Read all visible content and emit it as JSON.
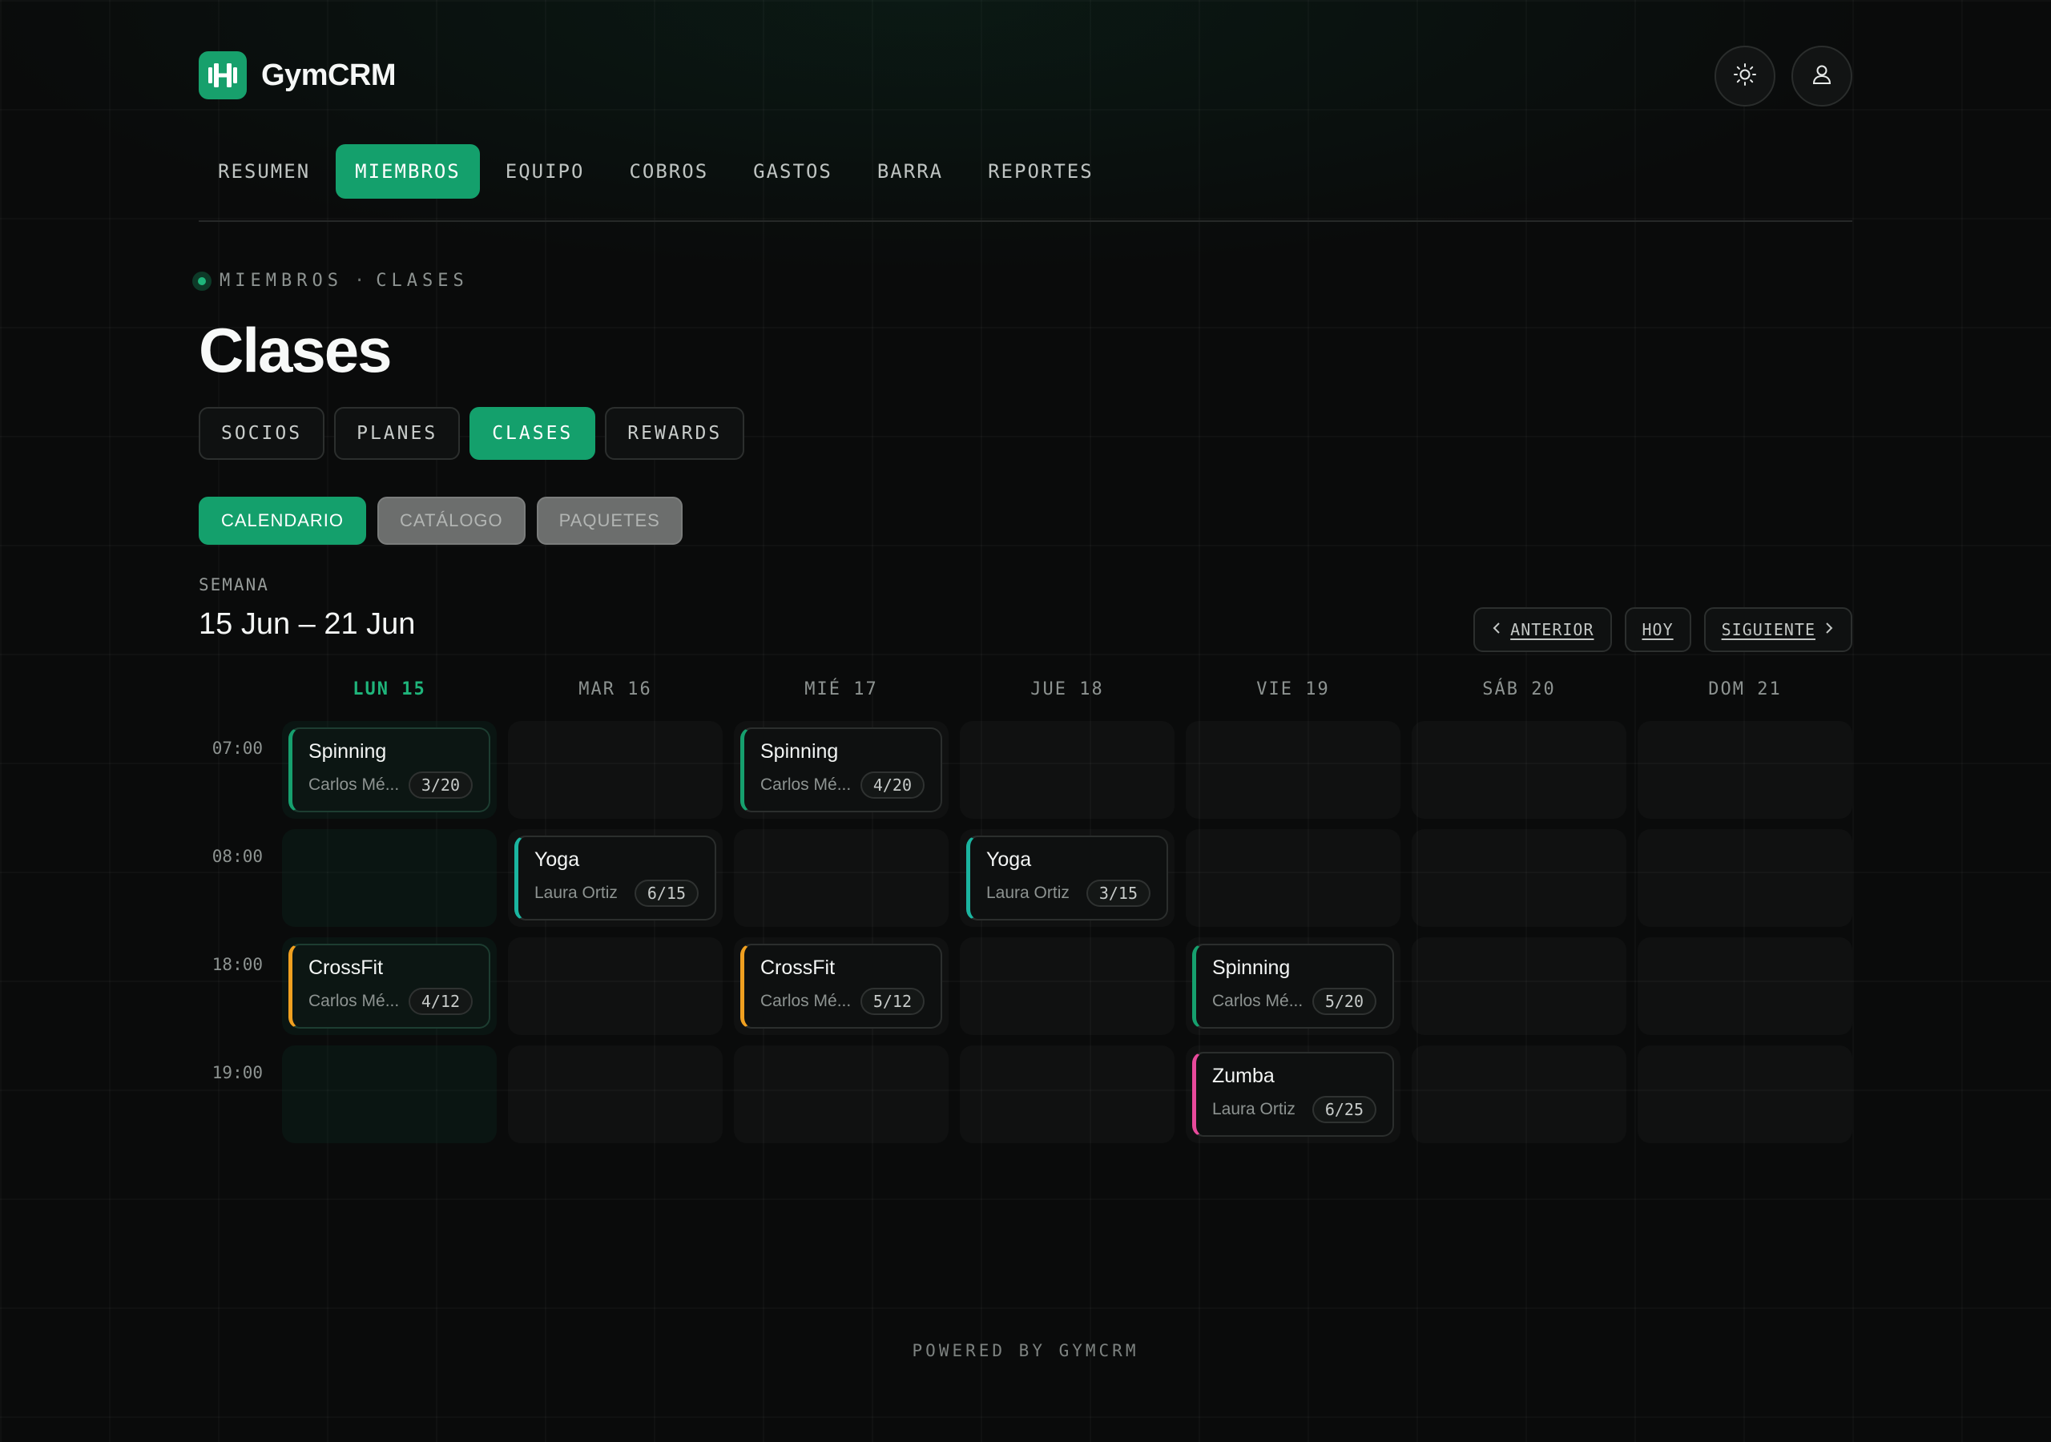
{
  "app": {
    "name": "GymCRM"
  },
  "header": {
    "theme_icon": "sun-icon",
    "account_icon": "user-icon"
  },
  "nav": [
    {
      "label": "RESUMEN",
      "active": false
    },
    {
      "label": "MIEMBROS",
      "active": true
    },
    {
      "label": "EQUIPO",
      "active": false
    },
    {
      "label": "COBROS",
      "active": false
    },
    {
      "label": "GASTOS",
      "active": false
    },
    {
      "label": "BARRA",
      "active": false
    },
    {
      "label": "REPORTES",
      "active": false
    }
  ],
  "breadcrumb": {
    "parent": "MIEMBROS",
    "separator": "·",
    "current": "CLASES"
  },
  "page": {
    "title": "Clases"
  },
  "subtabs": [
    {
      "label": "SOCIOS",
      "active": false
    },
    {
      "label": "PLANES",
      "active": false
    },
    {
      "label": "CLASES",
      "active": true
    },
    {
      "label": "REWARDS",
      "active": false
    }
  ],
  "views": [
    {
      "label": "CALENDARIO",
      "active": true
    },
    {
      "label": "CATÁLOGO",
      "active": false
    },
    {
      "label": "PAQUETES",
      "active": false
    }
  ],
  "week": {
    "label": "SEMANA",
    "range": "15 Jun – 21 Jun",
    "prev": "ANTERIOR",
    "today": "HOY",
    "next": "SIGUIENTE"
  },
  "calendar": {
    "days": [
      {
        "label": "LUN 15",
        "today": true
      },
      {
        "label": "MAR 16",
        "today": false
      },
      {
        "label": "MIÉ 17",
        "today": false
      },
      {
        "label": "JUE 18",
        "today": false
      },
      {
        "label": "VIE 19",
        "today": false
      },
      {
        "label": "SÁB 20",
        "today": false
      },
      {
        "label": "DOM 21",
        "today": false
      }
    ],
    "times": [
      "07:00",
      "08:00",
      "18:00",
      "19:00"
    ],
    "events": [
      {
        "day": 0,
        "slot": 0,
        "name": "Spinning",
        "instructor": "Carlos Mé...",
        "capacity": "3/20",
        "color": "#16a06e"
      },
      {
        "day": 2,
        "slot": 0,
        "name": "Spinning",
        "instructor": "Carlos Mé...",
        "capacity": "4/20",
        "color": "#16a06e"
      },
      {
        "day": 1,
        "slot": 1,
        "name": "Yoga",
        "instructor": "Laura Ortiz",
        "capacity": "6/15",
        "color": "#1bb5a0"
      },
      {
        "day": 3,
        "slot": 1,
        "name": "Yoga",
        "instructor": "Laura Ortiz",
        "capacity": "3/15",
        "color": "#1bb5a0"
      },
      {
        "day": 0,
        "slot": 2,
        "name": "CrossFit",
        "instructor": "Carlos Mé...",
        "capacity": "4/12",
        "color": "#f0a020"
      },
      {
        "day": 2,
        "slot": 2,
        "name": "CrossFit",
        "instructor": "Carlos Mé...",
        "capacity": "5/12",
        "color": "#f0a020"
      },
      {
        "day": 4,
        "slot": 2,
        "name": "Spinning",
        "instructor": "Carlos Mé...",
        "capacity": "5/20",
        "color": "#16a06e"
      },
      {
        "day": 4,
        "slot": 3,
        "name": "Zumba",
        "instructor": "Laura Ortiz",
        "capacity": "6/25",
        "color": "#e84a9b"
      }
    ]
  },
  "footer": {
    "text": "POWERED BY GYMCRM"
  },
  "colors": {
    "accent": "#14a06c",
    "background": "#0a0b0b"
  }
}
